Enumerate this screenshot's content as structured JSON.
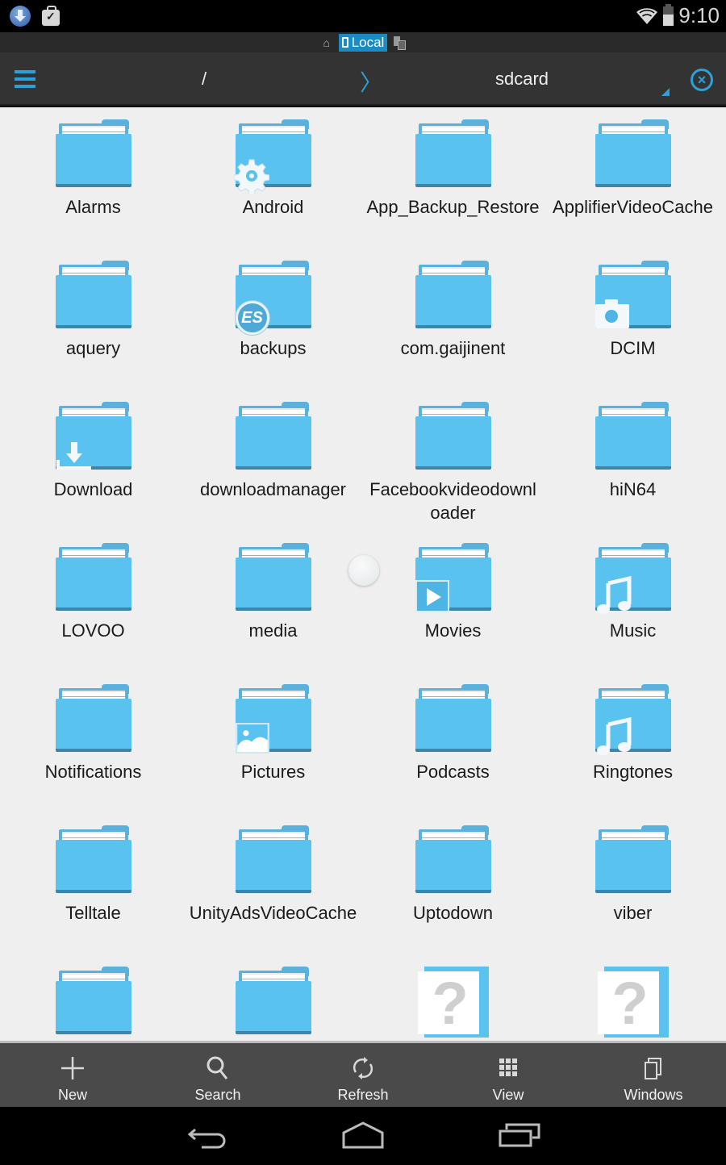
{
  "status_bar": {
    "left_icons": [
      "download-notification-icon",
      "briefcase-check-icon"
    ],
    "right_icons": [
      "wifi-icon",
      "battery-icon"
    ],
    "time": "9:10"
  },
  "location_bar": {
    "items": [
      {
        "icon": "home-icon",
        "label": ""
      },
      {
        "icon": "phone-icon",
        "label": "Local",
        "active": true
      },
      {
        "icon": "network-icon",
        "label": ""
      }
    ]
  },
  "path_bar": {
    "menu_icon": "hamburger-menu-icon",
    "breadcrumbs": [
      "/",
      "sdcard"
    ],
    "separator": "〉",
    "close_icon": "close-circle-icon",
    "accent_color": "#2ca0d8"
  },
  "files": [
    {
      "name": "Alarms",
      "type": "folder",
      "badge": null
    },
    {
      "name": "Android",
      "type": "folder",
      "badge": "gear"
    },
    {
      "name": "App_Backup_Restore",
      "type": "folder",
      "badge": null
    },
    {
      "name": "ApplifierVideoCache",
      "type": "folder",
      "badge": null
    },
    {
      "name": "aquery",
      "type": "folder",
      "badge": null
    },
    {
      "name": "backups",
      "type": "folder",
      "badge": "es"
    },
    {
      "name": "com.gaijinent",
      "type": "folder",
      "badge": null
    },
    {
      "name": "DCIM",
      "type": "folder",
      "badge": "camera"
    },
    {
      "name": "Download",
      "type": "folder",
      "badge": "download"
    },
    {
      "name": "downloadmanager",
      "type": "folder",
      "badge": null
    },
    {
      "name": "Facebookvideodownloader",
      "type": "folder",
      "badge": null
    },
    {
      "name": "hiN64",
      "type": "folder",
      "badge": null
    },
    {
      "name": "LOVOO",
      "type": "folder",
      "badge": null
    },
    {
      "name": "media",
      "type": "folder",
      "badge": null
    },
    {
      "name": "Movies",
      "type": "folder",
      "badge": "play"
    },
    {
      "name": "Music",
      "type": "folder",
      "badge": "music"
    },
    {
      "name": "Notifications",
      "type": "folder",
      "badge": null
    },
    {
      "name": "Pictures",
      "type": "folder",
      "badge": "picture"
    },
    {
      "name": "Podcasts",
      "type": "folder",
      "badge": null
    },
    {
      "name": "Ringtones",
      "type": "folder",
      "badge": "music"
    },
    {
      "name": "Telltale",
      "type": "folder",
      "badge": null
    },
    {
      "name": "UnityAdsVideoCache",
      "type": "folder",
      "badge": null
    },
    {
      "name": "Uptodown",
      "type": "folder",
      "badge": null
    },
    {
      "name": "viber",
      "type": "folder",
      "badge": null
    },
    {
      "name": "",
      "type": "folder",
      "badge": null
    },
    {
      "name": "",
      "type": "folder",
      "badge": null
    },
    {
      "name": "",
      "type": "unknown",
      "badge": null
    },
    {
      "name": "",
      "type": "unknown",
      "badge": null
    }
  ],
  "toolbar": {
    "buttons": [
      {
        "icon": "plus-icon",
        "label": "New"
      },
      {
        "icon": "search-icon",
        "label": "Search"
      },
      {
        "icon": "refresh-icon",
        "label": "Refresh"
      },
      {
        "icon": "grid-view-icon",
        "label": "View"
      },
      {
        "icon": "windows-icon",
        "label": "Windows"
      }
    ]
  },
  "nav_bar": {
    "buttons": [
      "back-icon",
      "home-icon",
      "recent-apps-icon"
    ]
  },
  "colors": {
    "folder": "#5ac2ef",
    "accent": "#2ca0d8",
    "local_tab": "#1a8bc4"
  }
}
